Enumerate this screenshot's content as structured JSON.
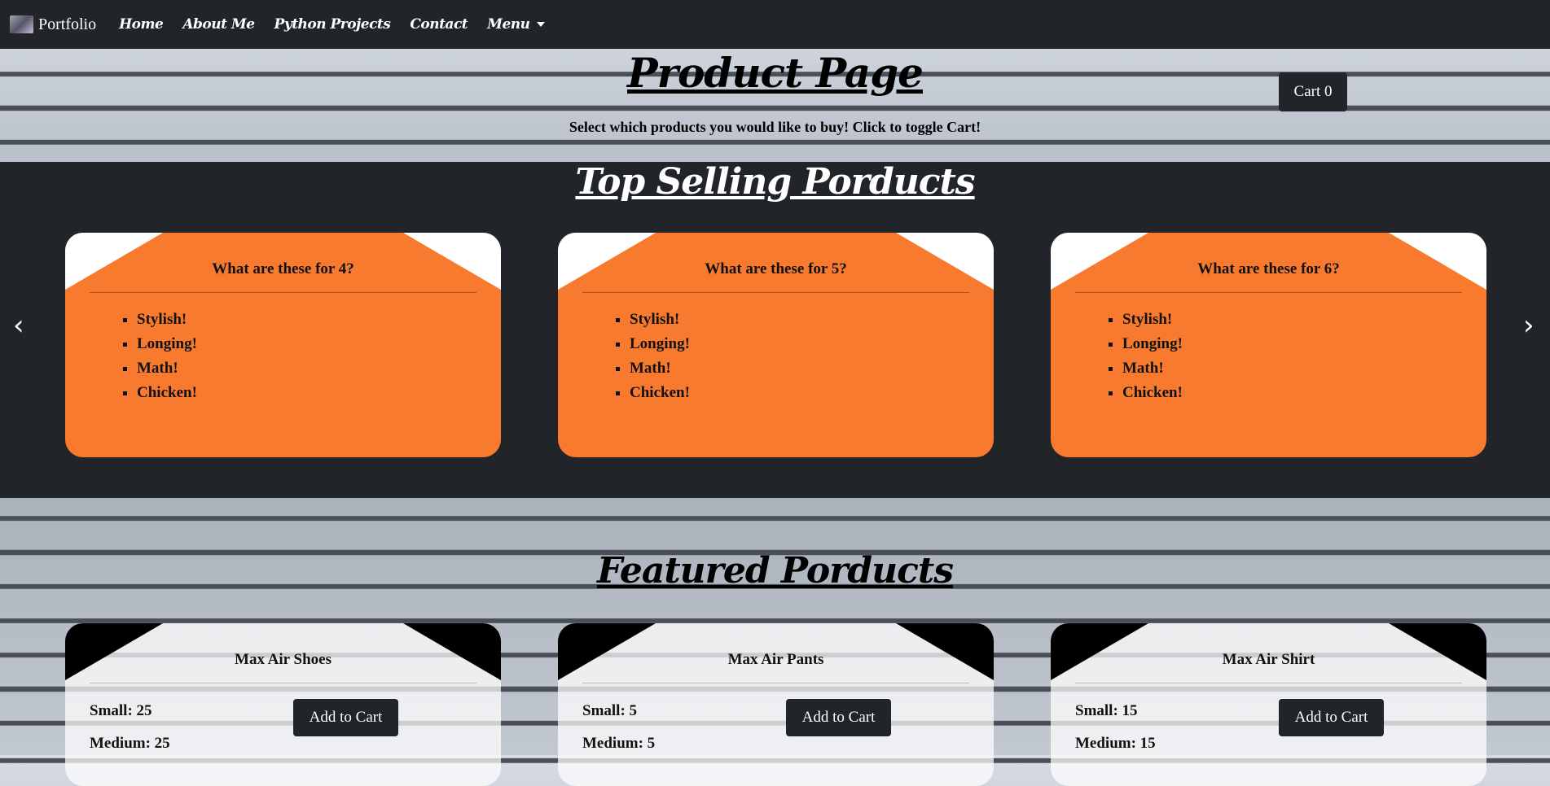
{
  "nav": {
    "brand": "Portfolio",
    "links": [
      "Home",
      "About Me",
      "Python Projects",
      "Contact"
    ],
    "menu": "Menu"
  },
  "header": {
    "title": "Product Page",
    "subtitle": "Select which products you would like to buy! Click to toggle Cart!",
    "cart_label": "Cart 0"
  },
  "top_selling": {
    "title": "Top Selling Porducts",
    "prev_arrow": "‹",
    "next_arrow": "›",
    "cards": [
      {
        "title": "What are these for 4?",
        "items": [
          "Stylish!",
          "Longing!",
          "Math!",
          "Chicken!"
        ]
      },
      {
        "title": "What are these for 5?",
        "items": [
          "Stylish!",
          "Longing!",
          "Math!",
          "Chicken!"
        ]
      },
      {
        "title": "What are these for 6?",
        "items": [
          "Stylish!",
          "Longing!",
          "Math!",
          "Chicken!"
        ]
      }
    ]
  },
  "featured": {
    "title": "Featured Porducts",
    "add_label": "Add to Cart",
    "products": [
      {
        "name": "Max Air Shoes",
        "small": "Small: 25",
        "medium": "Medium: 25"
      },
      {
        "name": "Max Air Pants",
        "small": "Small: 5",
        "medium": "Medium: 5"
      },
      {
        "name": "Max Air Shirt",
        "small": "Small: 15",
        "medium": "Medium: 15"
      }
    ]
  },
  "colors": {
    "dark": "#212529",
    "orange": "#f77a2f"
  }
}
